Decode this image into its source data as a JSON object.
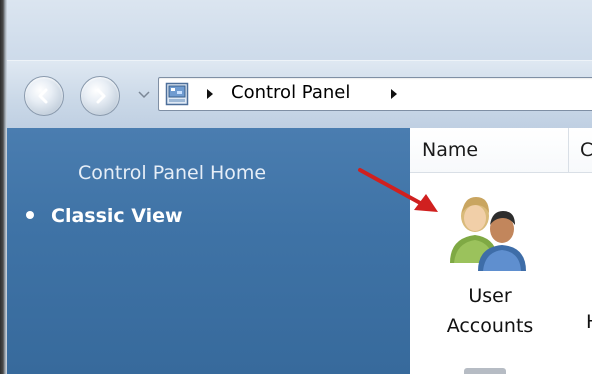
{
  "address_bar": {
    "breadcrumbs": [
      {
        "label": "Control Panel"
      }
    ]
  },
  "sidebar": {
    "items": [
      {
        "label": "Control Panel Home"
      },
      {
        "label": "Classic View"
      }
    ]
  },
  "list": {
    "columns": [
      {
        "label": "Name"
      },
      {
        "label": "C"
      }
    ],
    "items": [
      {
        "label_line1": "User",
        "label_line2": "Accounts",
        "icon": "user-accounts-icon"
      },
      {
        "label": "H"
      }
    ]
  },
  "colors": {
    "sidebar_bg": "#3f73a6",
    "annotation_arrow": "#d0201f",
    "glass": "#cbd9e8"
  }
}
